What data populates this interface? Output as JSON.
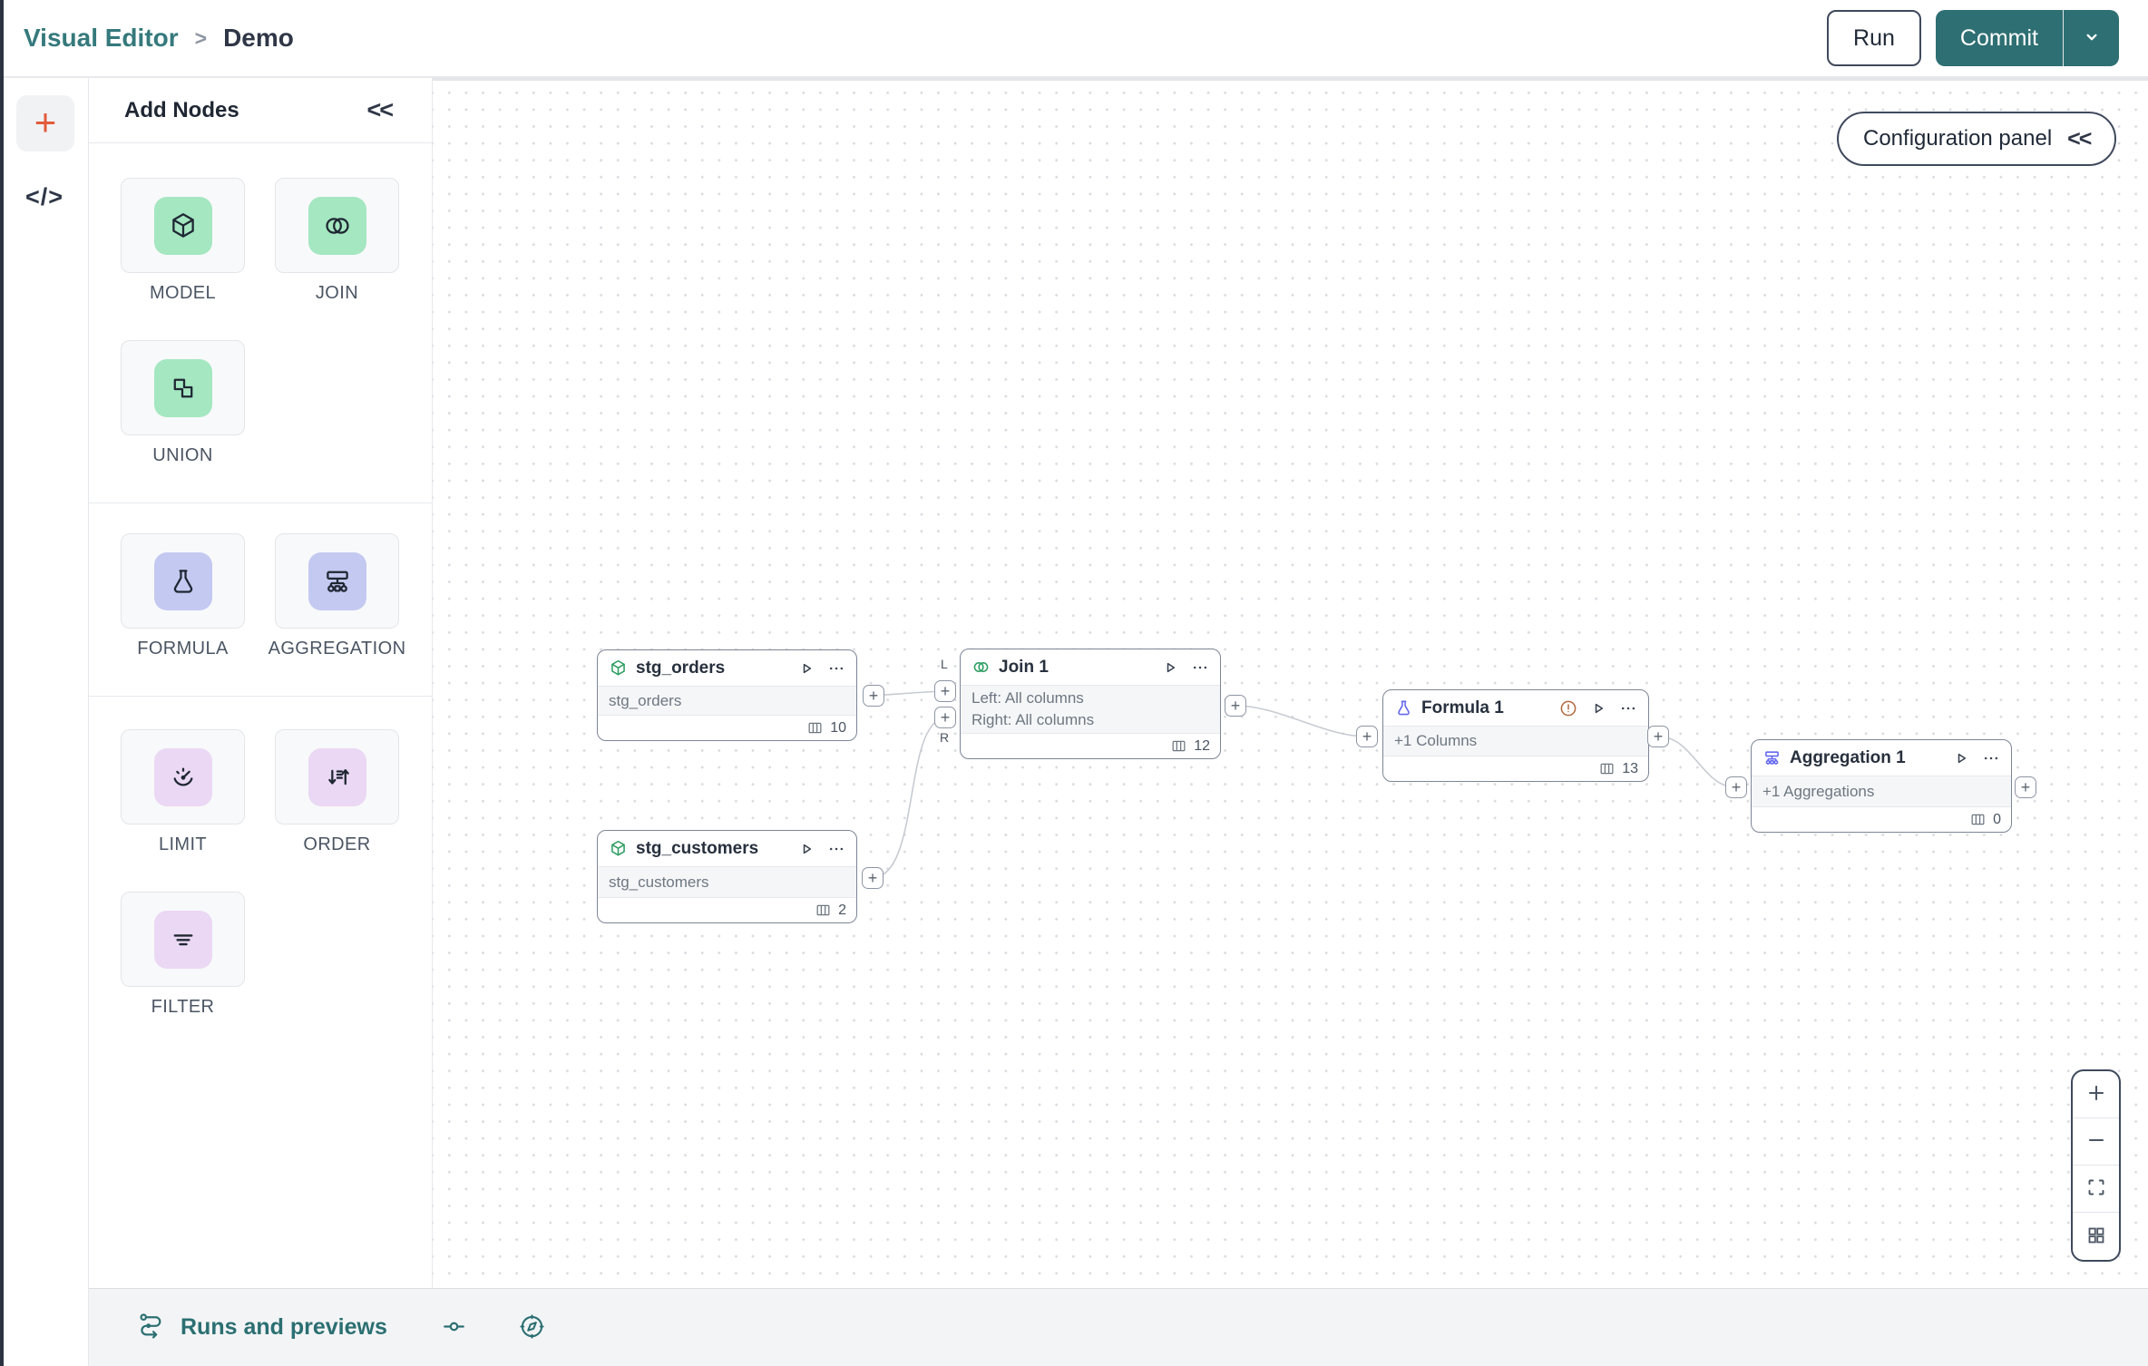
{
  "header": {
    "breadcrumb": {
      "root": "Visual Editor",
      "separator": ">",
      "current": "Demo"
    },
    "run_label": "Run",
    "commit_label": "Commit"
  },
  "icons": {
    "plus": "+",
    "code": "</>"
  },
  "sidebar": {
    "title": "Add Nodes",
    "collapse_icon": "<<",
    "sections": [
      {
        "items": [
          {
            "label": "MODEL"
          },
          {
            "label": "JOIN"
          },
          {
            "label": "UNION"
          }
        ]
      },
      {
        "items": [
          {
            "label": "FORMULA"
          },
          {
            "label": "AGGREGATION"
          }
        ]
      },
      {
        "items": [
          {
            "label": "LIMIT"
          },
          {
            "label": "ORDER"
          },
          {
            "label": "FILTER"
          }
        ]
      }
    ]
  },
  "canvas": {
    "config_panel": {
      "label": "Configuration panel",
      "collapse_icon": "<<"
    },
    "port_plus": "+",
    "nodes": [
      {
        "title": "stg_orders",
        "body": "stg_orders",
        "columns": "10"
      },
      {
        "title": "Join 1",
        "body_line1": "Left: All columns",
        "body_line2": "Right: All columns",
        "columns": "12",
        "left_port_label": "L",
        "right_port_label": "R"
      },
      {
        "title": "Formula 1",
        "body": "+1 Columns",
        "columns": "13"
      },
      {
        "title": "Aggregation 1",
        "body": "+1 Aggregations",
        "columns": "0"
      },
      {
        "title": "stg_customers",
        "body": "stg_customers",
        "columns": "2"
      }
    ]
  },
  "bottom_bar": {
    "label": "Runs and previews"
  },
  "colors": {
    "teal": "#2e6f73",
    "teal_link": "#35797c",
    "orange": "#e25b3c",
    "green_tile": "#a4e7c1",
    "lavender_tile": "#c4c9f1",
    "pink_tile": "#ead8f4",
    "icon_green": "#2f9e63",
    "icon_purple": "#6467ef",
    "warning": "#b06a3f",
    "dark_text": "#2f3747",
    "muted_text": "#6e7781"
  }
}
